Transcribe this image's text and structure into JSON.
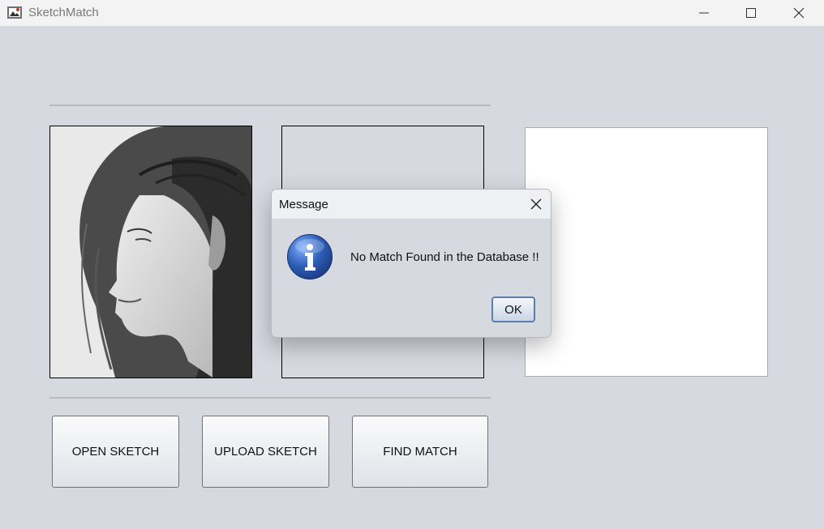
{
  "window": {
    "title": "SketchMatch",
    "icon": "sketchmatch-app-icon"
  },
  "toolbar": {
    "open_sketch_label": "OPEN SKETCH",
    "upload_sketch_label": "UPLOAD SKETCH",
    "find_match_label": "FIND MATCH"
  },
  "panels": {
    "sketch": {
      "content": "pencil sketch portrait (profile view)"
    },
    "upload": {
      "content": ""
    },
    "result": {
      "content": ""
    }
  },
  "dialog": {
    "title": "Message",
    "message": "No Match Found in the Database !!",
    "ok_label": "OK",
    "icon": "info-icon"
  },
  "colors": {
    "background": "#d6d9e0",
    "info_blue": "#2e5fb8",
    "ok_border": "#5b7fa8"
  }
}
